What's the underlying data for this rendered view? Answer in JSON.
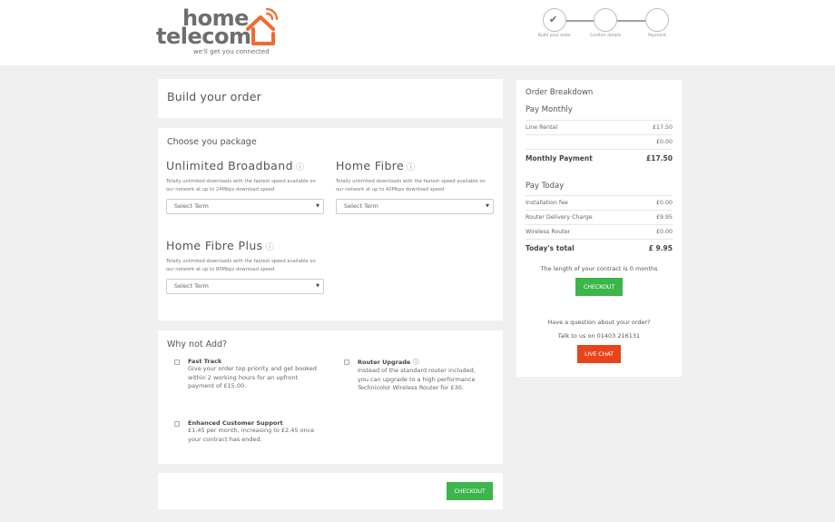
{
  "brand": {
    "line1": "home",
    "line2": "telecom",
    "tagline": "we'll get you connected",
    "icon": "house-wifi-icon",
    "accent_color": "#f26b2b"
  },
  "progress": {
    "steps": [
      {
        "label": "Build your order",
        "state": "complete",
        "icon": "check-icon"
      },
      {
        "label": "Confirm details",
        "state": "pending"
      },
      {
        "label": "Payment",
        "state": "pending"
      }
    ]
  },
  "main": {
    "page_title": "Build your order",
    "packages_heading": "Choose you package",
    "packages": [
      {
        "name": "Unlimited Broadband",
        "icon": "info-icon",
        "description": "Totally unlimited downloads with the fastest speed available on our network at up to 24Mbps download speed",
        "select_value": "Select Term"
      },
      {
        "name": "Home Fibre",
        "icon": "info-icon",
        "description": "Totally unlimited downloads with the fastest speed available on our network at up to 40Mbps download speed",
        "select_value": "Select Term"
      },
      {
        "name": "Home Fibre Plus",
        "icon": "info-icon",
        "description": "Totally unlimited downloads with the fastest speed available on our network at up to 80Mbps download speed",
        "select_value": "Select Term"
      }
    ],
    "addons_heading": "Why not Add?",
    "addons": [
      {
        "title": "Fast Track",
        "description": "Give your order top priority and get booked within 2 working hours for an upfront payment of £15.00.",
        "checked": false
      },
      {
        "title": "Router Upgrade",
        "icon": "info-icon",
        "description": "Instead of the standard router included, you can upgrade to a high performance Technicolor Wireless Router for £30.",
        "checked": false
      },
      {
        "title": "Enhanced Customer Support",
        "description": "£1.45 per month, increasing to £2.45 once your contract has ended.",
        "checked": false
      }
    ],
    "checkout_label": "CHECKOUT"
  },
  "sidebar": {
    "title": "Order Breakdown",
    "monthly_heading": "Pay Monthly",
    "monthly_rows": [
      {
        "label": "Line Rental",
        "value": "£17.50"
      },
      {
        "label": "",
        "value": "£0.00"
      }
    ],
    "monthly_total": {
      "label": "Monthly Payment",
      "value": "£17.50"
    },
    "today_heading": "Pay Today",
    "today_rows": [
      {
        "label": "Installation fee",
        "value": "£0.00"
      },
      {
        "label": "Router Delivery Charge",
        "value": "£9.95"
      },
      {
        "label": "Wireless Router",
        "value": "£0.00"
      }
    ],
    "today_total": {
      "label": "Today's total",
      "value": "£ 9.95"
    },
    "contract_text": "The length of your contract is 0 months",
    "checkout_label": "CHECKOUT",
    "question_text": "Have a question about your order?",
    "phone_text": "Talk to us on 01403 216131",
    "live_chat_label": "LIVE CHAT"
  },
  "colors": {
    "checkout_green": "#3cb54a",
    "live_chat_red": "#e8441b",
    "background": "#f0f0f0"
  }
}
